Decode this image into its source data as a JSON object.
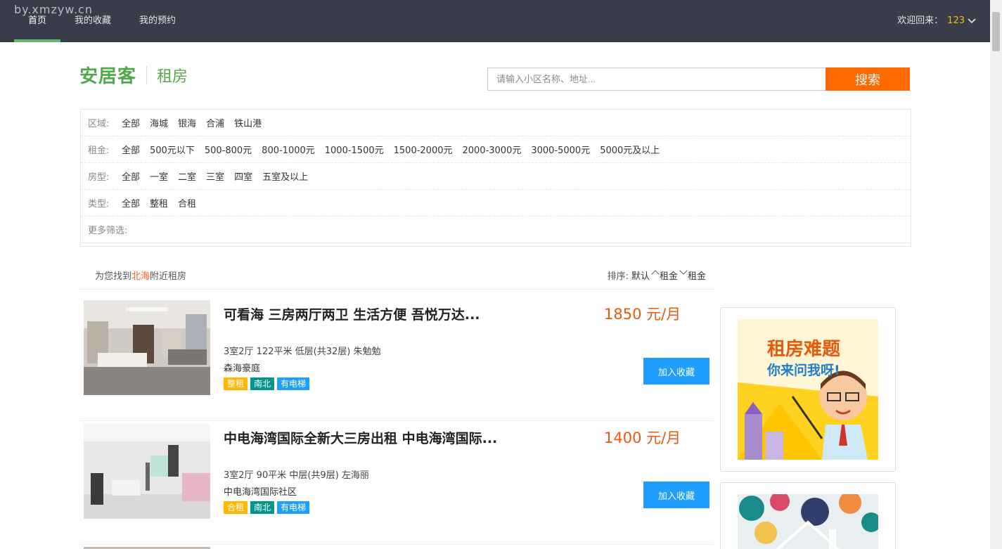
{
  "watermark": "by.xmzyw.cn",
  "nav": {
    "items": [
      {
        "label": "首页"
      },
      {
        "label": "我的收藏"
      },
      {
        "label": "我的预约"
      }
    ]
  },
  "user": {
    "greeting": "欢迎回来：",
    "name": "123"
  },
  "brand": {
    "logo": "安居客",
    "sub": "租房"
  },
  "search": {
    "placeholder": "请输入小区名称、地址...",
    "button": "搜索"
  },
  "filters": {
    "area": {
      "label": "区域:",
      "options": [
        "全部",
        "海城",
        "银海",
        "合浦",
        "铁山港"
      ]
    },
    "rent": {
      "label": "租金:",
      "options": [
        "全部",
        "500元以下",
        "500-800元",
        "800-1000元",
        "1000-1500元",
        "1500-2000元",
        "2000-3000元",
        "3000-5000元",
        "5000元及以上"
      ]
    },
    "room": {
      "label": "房型:",
      "options": [
        "全部",
        "一室",
        "二室",
        "三室",
        "四室",
        "五室及以上"
      ]
    },
    "type": {
      "label": "类型:",
      "options": [
        "全部",
        "整租",
        "合租"
      ]
    },
    "more": {
      "label": "更多筛选:"
    }
  },
  "results": {
    "prefix": "为您找到",
    "city": "北海",
    "suffix": "附近租房",
    "sort_label": "排序:",
    "sort_default": "默认",
    "sort_rent_up": "租金",
    "sort_rent_down": "租金"
  },
  "listings": [
    {
      "title": "可看海 三房两厅两卫 生活方便 吾悦万达...",
      "price": "1850 元/月",
      "meta": "3室2厅 122平米 低层(共32层) 朱勉勉",
      "community": "森海豪庭",
      "tags": [
        "整租",
        "南北",
        "有电梯"
      ],
      "button": "加入收藏"
    },
    {
      "title": "中电海湾国际全新大三房出租 中电海湾国际...",
      "price": "1400 元/月",
      "meta": "3室2厅 90平米 中层(共9层) 左海丽",
      "community": "中电海湾国际社区",
      "tags": [
        "合租",
        "南北",
        "有电梯"
      ],
      "button": "加入收藏"
    }
  ],
  "ads": {
    "ad1_line1": "租房难题",
    "ad1_line2": "你来问我呀!"
  },
  "colors": {
    "topbar": "#393D49",
    "nav_active": "#5FB878",
    "username": "#FFB800",
    "search_button": "#FF6A00",
    "price": "#E8590C",
    "fav_button": "#1E9FFF"
  }
}
